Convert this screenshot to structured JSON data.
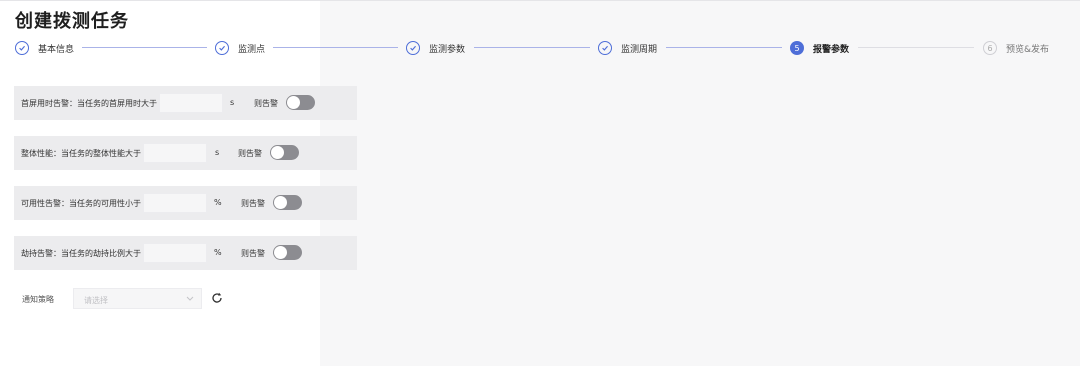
{
  "page": {
    "title": "创建拨测任务"
  },
  "steps": [
    {
      "label": "基本信息",
      "status": "done"
    },
    {
      "label": "监测点",
      "status": "done"
    },
    {
      "label": "监测参数",
      "status": "done"
    },
    {
      "label": "监测周期",
      "status": "done"
    },
    {
      "label": "报警参数",
      "status": "active",
      "number": "5"
    },
    {
      "label": "预览&发布",
      "status": "pending",
      "number": "6"
    }
  ],
  "alerts": [
    {
      "label": "首屏用时告警：当任务的首屏用时大于",
      "value": "",
      "unit": "s",
      "suffix": "则告警",
      "enabled": false
    },
    {
      "label": "整体性能：当任务的整体性能大于",
      "value": "",
      "unit": "s",
      "suffix": "则告警",
      "enabled": false
    },
    {
      "label": "可用性告警：当任务的可用性小于",
      "value": "",
      "unit": "%",
      "suffix": "则告警",
      "enabled": false
    },
    {
      "label": "劫持告警：当任务的劫持比例大于",
      "value": "",
      "unit": "%",
      "suffix": "则告警",
      "enabled": false
    }
  ],
  "notify": {
    "label": "通知策略",
    "placeholder": "请选择"
  },
  "icons": {
    "step_done": "check-icon",
    "select": "chevron-down-icon",
    "refresh": "refresh-icon"
  },
  "colors": {
    "accent": "#4e6ed8",
    "row_bg": "#ececee",
    "toggle_off": "#8c8c91"
  }
}
